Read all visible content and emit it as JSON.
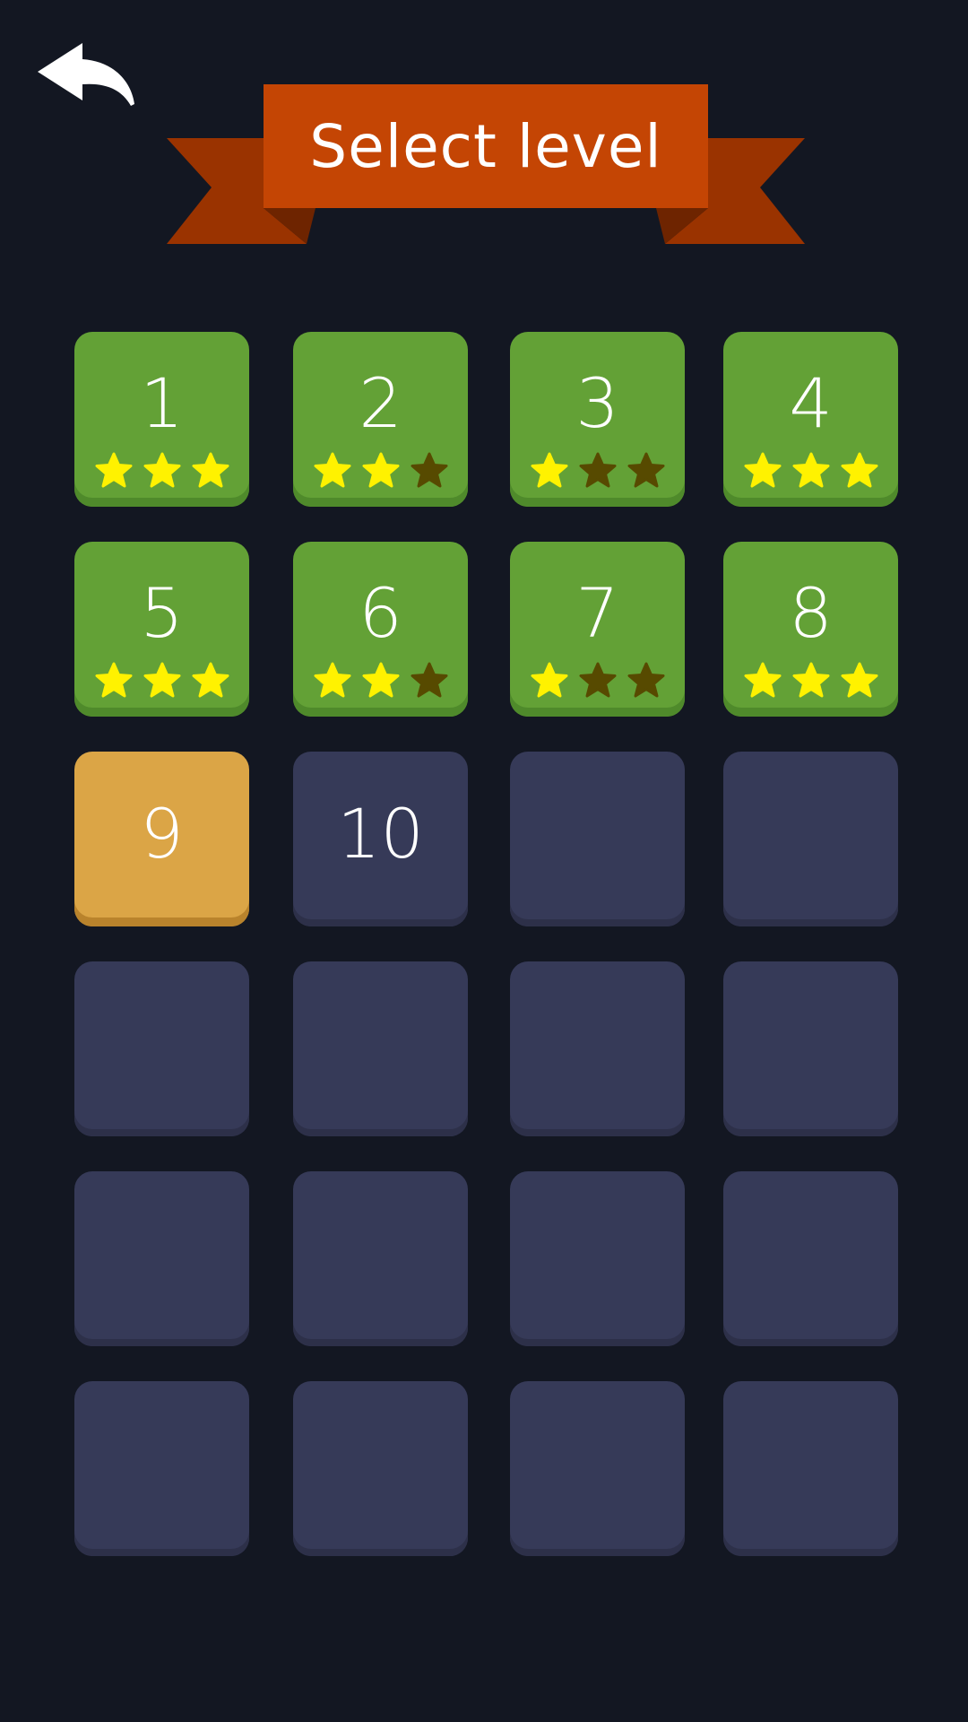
{
  "header": {
    "title": "Select level",
    "back_icon": "back-arrow-icon"
  },
  "colors": {
    "background": "#131722",
    "banner": "#c44504",
    "banner_tail": "#9a3300",
    "tile_complete": "#63a136",
    "tile_current": "#dba546",
    "tile_locked": "#363a58",
    "star_on": "#fff200",
    "star_off": "#574a00"
  },
  "levels": [
    {
      "label": "1",
      "state": "complete",
      "stars": 3
    },
    {
      "label": "2",
      "state": "complete",
      "stars": 2
    },
    {
      "label": "3",
      "state": "complete",
      "stars": 1
    },
    {
      "label": "4",
      "state": "complete",
      "stars": 3
    },
    {
      "label": "5",
      "state": "complete",
      "stars": 3
    },
    {
      "label": "6",
      "state": "complete",
      "stars": 2
    },
    {
      "label": "7",
      "state": "complete",
      "stars": 1
    },
    {
      "label": "8",
      "state": "complete",
      "stars": 3
    },
    {
      "label": "9",
      "state": "current",
      "stars": 0
    },
    {
      "label": "10",
      "state": "locked",
      "stars": 0
    },
    {
      "label": "",
      "state": "locked",
      "stars": 0
    },
    {
      "label": "",
      "state": "locked",
      "stars": 0
    },
    {
      "label": "",
      "state": "locked",
      "stars": 0
    },
    {
      "label": "",
      "state": "locked",
      "stars": 0
    },
    {
      "label": "",
      "state": "locked",
      "stars": 0
    },
    {
      "label": "",
      "state": "locked",
      "stars": 0
    },
    {
      "label": "",
      "state": "locked",
      "stars": 0
    },
    {
      "label": "",
      "state": "locked",
      "stars": 0
    },
    {
      "label": "",
      "state": "locked",
      "stars": 0
    },
    {
      "label": "",
      "state": "locked",
      "stars": 0
    },
    {
      "label": "",
      "state": "locked",
      "stars": 0
    },
    {
      "label": "",
      "state": "locked",
      "stars": 0
    },
    {
      "label": "",
      "state": "locked",
      "stars": 0
    },
    {
      "label": "",
      "state": "locked",
      "stars": 0
    }
  ]
}
